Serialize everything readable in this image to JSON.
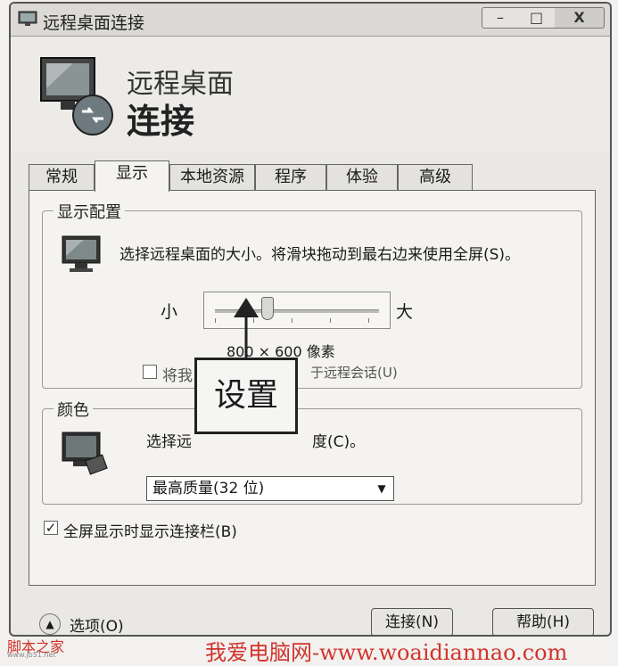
{
  "window": {
    "title": "远程桌面连接",
    "buttons": {
      "minimize": "–",
      "maximize": "□",
      "close": "X"
    }
  },
  "header": {
    "line1": "远程桌面",
    "line2": "连接"
  },
  "tabs": [
    {
      "label": "常规"
    },
    {
      "label": "显示"
    },
    {
      "label": "本地资源"
    },
    {
      "label": "程序"
    },
    {
      "label": "体验"
    },
    {
      "label": "高级"
    }
  ],
  "active_tab": "显示",
  "display_config": {
    "title": "显示配置",
    "description": "选择远程桌面的大小。将滑块拖动到最右边来使用全屏(S)。",
    "slider_small": "小",
    "slider_large": "大",
    "slider_value": 0.3,
    "resolution": "800 × 600 像素",
    "multi_monitor_prefix": "将我",
    "multi_monitor_suffix": "于远程会话(U)",
    "multi_monitor_checked": false
  },
  "color": {
    "title": "颜色",
    "description_prefix": "选择远",
    "description_suffix": "度(C)。",
    "selected": "最高质量(32 位)"
  },
  "fullscreen_bar": {
    "label": "全屏显示时显示连接栏(B)",
    "checked": true
  },
  "annotation": {
    "label": "设置"
  },
  "footer": {
    "options_label": "选项(O)",
    "connect_label": "连接(N)",
    "help_label": "帮助(H)"
  },
  "watermarks": {
    "left": "脚本之家",
    "left_sub": "www.jb51.net",
    "right": "我爱电脑网-www.woaidiannao.com"
  },
  "colors": {
    "accent": "#d0342c",
    "window_bg": "#e9e8e5"
  }
}
